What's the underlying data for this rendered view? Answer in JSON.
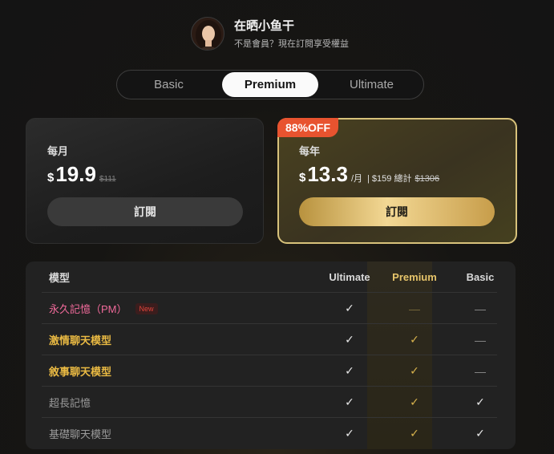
{
  "user": {
    "name": "在晒小鱼干",
    "subtitle": "不是會員？現在訂閱享受權益"
  },
  "tabs": [
    {
      "label": "Basic",
      "active": false
    },
    {
      "label": "Premium",
      "active": true
    },
    {
      "label": "Ultimate",
      "active": false
    }
  ],
  "plans": {
    "monthly": {
      "period": "每月",
      "currency": "$",
      "amount": "19.9",
      "original": "$111",
      "button": "訂閱"
    },
    "yearly": {
      "badge": "88%OFF",
      "period": "每年",
      "currency": "$",
      "amount": "13.3",
      "unit": "/月",
      "total": "| $159 總計",
      "original": "$1306",
      "button": "訂閱"
    }
  },
  "table": {
    "headers": {
      "model": "模型",
      "ultimate": "Ultimate",
      "premium": "Premium",
      "basic": "Basic"
    },
    "rows": [
      {
        "name": "永久記憶（PM）",
        "badge": "New",
        "style": "pink",
        "ultimate": "✓",
        "premium": "—",
        "basic": "—"
      },
      {
        "name": "激情聊天模型",
        "style": "gold",
        "ultimate": "✓",
        "premium": "✓",
        "basic": "—"
      },
      {
        "name": "敘事聊天模型",
        "style": "gold",
        "ultimate": "✓",
        "premium": "✓",
        "basic": "—"
      },
      {
        "name": "超長記憶",
        "style": "gray",
        "ultimate": "✓",
        "premium": "✓",
        "basic": "✓"
      },
      {
        "name": "基礎聊天模型",
        "style": "gray",
        "ultimate": "✓",
        "premium": "✓",
        "basic": "✓"
      }
    ]
  },
  "colors": {
    "accent_gold": "#e9b943",
    "badge_red": "#e8532f",
    "premium_header": "#e6c46a"
  }
}
